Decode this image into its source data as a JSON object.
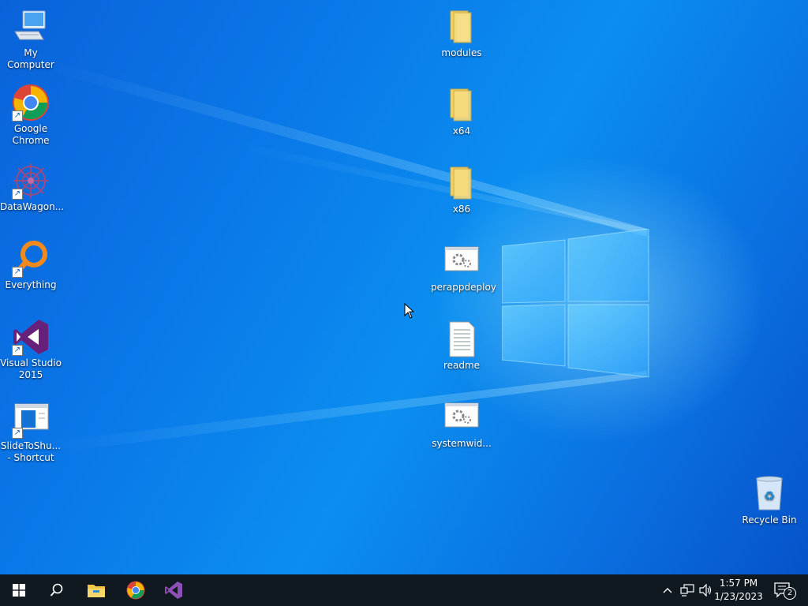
{
  "desktop": {
    "left_icons": [
      {
        "name": "My Computer",
        "icon": "computer-icon"
      },
      {
        "name": "Google Chrome",
        "icon": "chrome-icon"
      },
      {
        "name": "DataWagon...",
        "icon": "datawagon-icon"
      },
      {
        "name": "Everything",
        "icon": "everything-search-icon"
      },
      {
        "name": "Visual Studio 2015",
        "icon": "visual-studio-icon"
      },
      {
        "name": "SlideToShu... - Shortcut",
        "icon": "slidetoshutdown-icon"
      }
    ],
    "center_icons": [
      {
        "name": "modules",
        "icon": "folder-icon"
      },
      {
        "name": "x64",
        "icon": "folder-icon"
      },
      {
        "name": "x86",
        "icon": "folder-icon"
      },
      {
        "name": "perappdeploy",
        "icon": "settings-file-icon"
      },
      {
        "name": "readme",
        "icon": "text-file-icon"
      },
      {
        "name": "systemwid...",
        "icon": "settings-file-icon"
      }
    ],
    "recycle_bin": {
      "name": "Recycle Bin",
      "icon": "recycle-bin-icon"
    }
  },
  "taskbar": {
    "pinned": [
      {
        "name": "Start",
        "icon": "windows-start-icon"
      },
      {
        "name": "Search",
        "icon": "search-icon"
      },
      {
        "name": "File Explorer",
        "icon": "file-explorer-icon"
      },
      {
        "name": "Google Chrome",
        "icon": "chrome-icon"
      },
      {
        "name": "Visual Studio",
        "icon": "visual-studio-icon"
      }
    ],
    "clock": {
      "time": "1:57 PM",
      "date": "1/23/2023"
    },
    "notifications_count": "2"
  },
  "colors": {
    "desktop_blue": "#0a78e8",
    "taskbar": "#101820",
    "folder_yellow": "#f4d36b",
    "vs_purple": "#68217a"
  }
}
